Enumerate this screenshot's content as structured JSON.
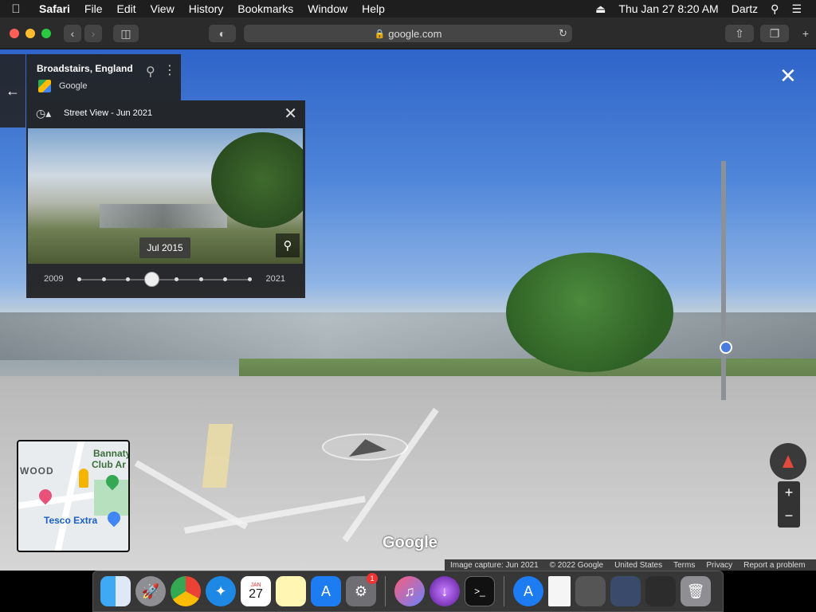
{
  "menubar": {
    "app": "Safari",
    "items": [
      "File",
      "Edit",
      "View",
      "History",
      "Bookmarks",
      "Window",
      "Help"
    ],
    "datetime": "Thu Jan 27  8:20 AM",
    "user": "Dartz"
  },
  "toolbar": {
    "url": "google.com"
  },
  "location": {
    "title": "Broadstairs, England",
    "provider": "Google"
  },
  "timemachine": {
    "title": "Street View - Jun 2021",
    "selected_date": "Jul 2015",
    "year_start": "2009",
    "year_end": "2021",
    "dot_count": 8,
    "selected_index": 3
  },
  "minimap": {
    "label_bannatyne": "Bannaty",
    "label_club": "Club Ar",
    "label_wood": "WOOD",
    "label_tesco": "Tesco Extra"
  },
  "logo": "Google",
  "footer": {
    "capture": "Image capture: Jun 2021",
    "copyright": "© 2022 Google",
    "country": "United States",
    "terms": "Terms",
    "privacy": "Privacy",
    "report": "Report a problem"
  },
  "dock": {
    "calendar_month": "JAN",
    "calendar_day": "27",
    "settings_badge": "1"
  },
  "colors": {
    "accent_red": "#e24a3b",
    "sky_blue": "#2f64c9",
    "panel_bg": "#222222"
  }
}
